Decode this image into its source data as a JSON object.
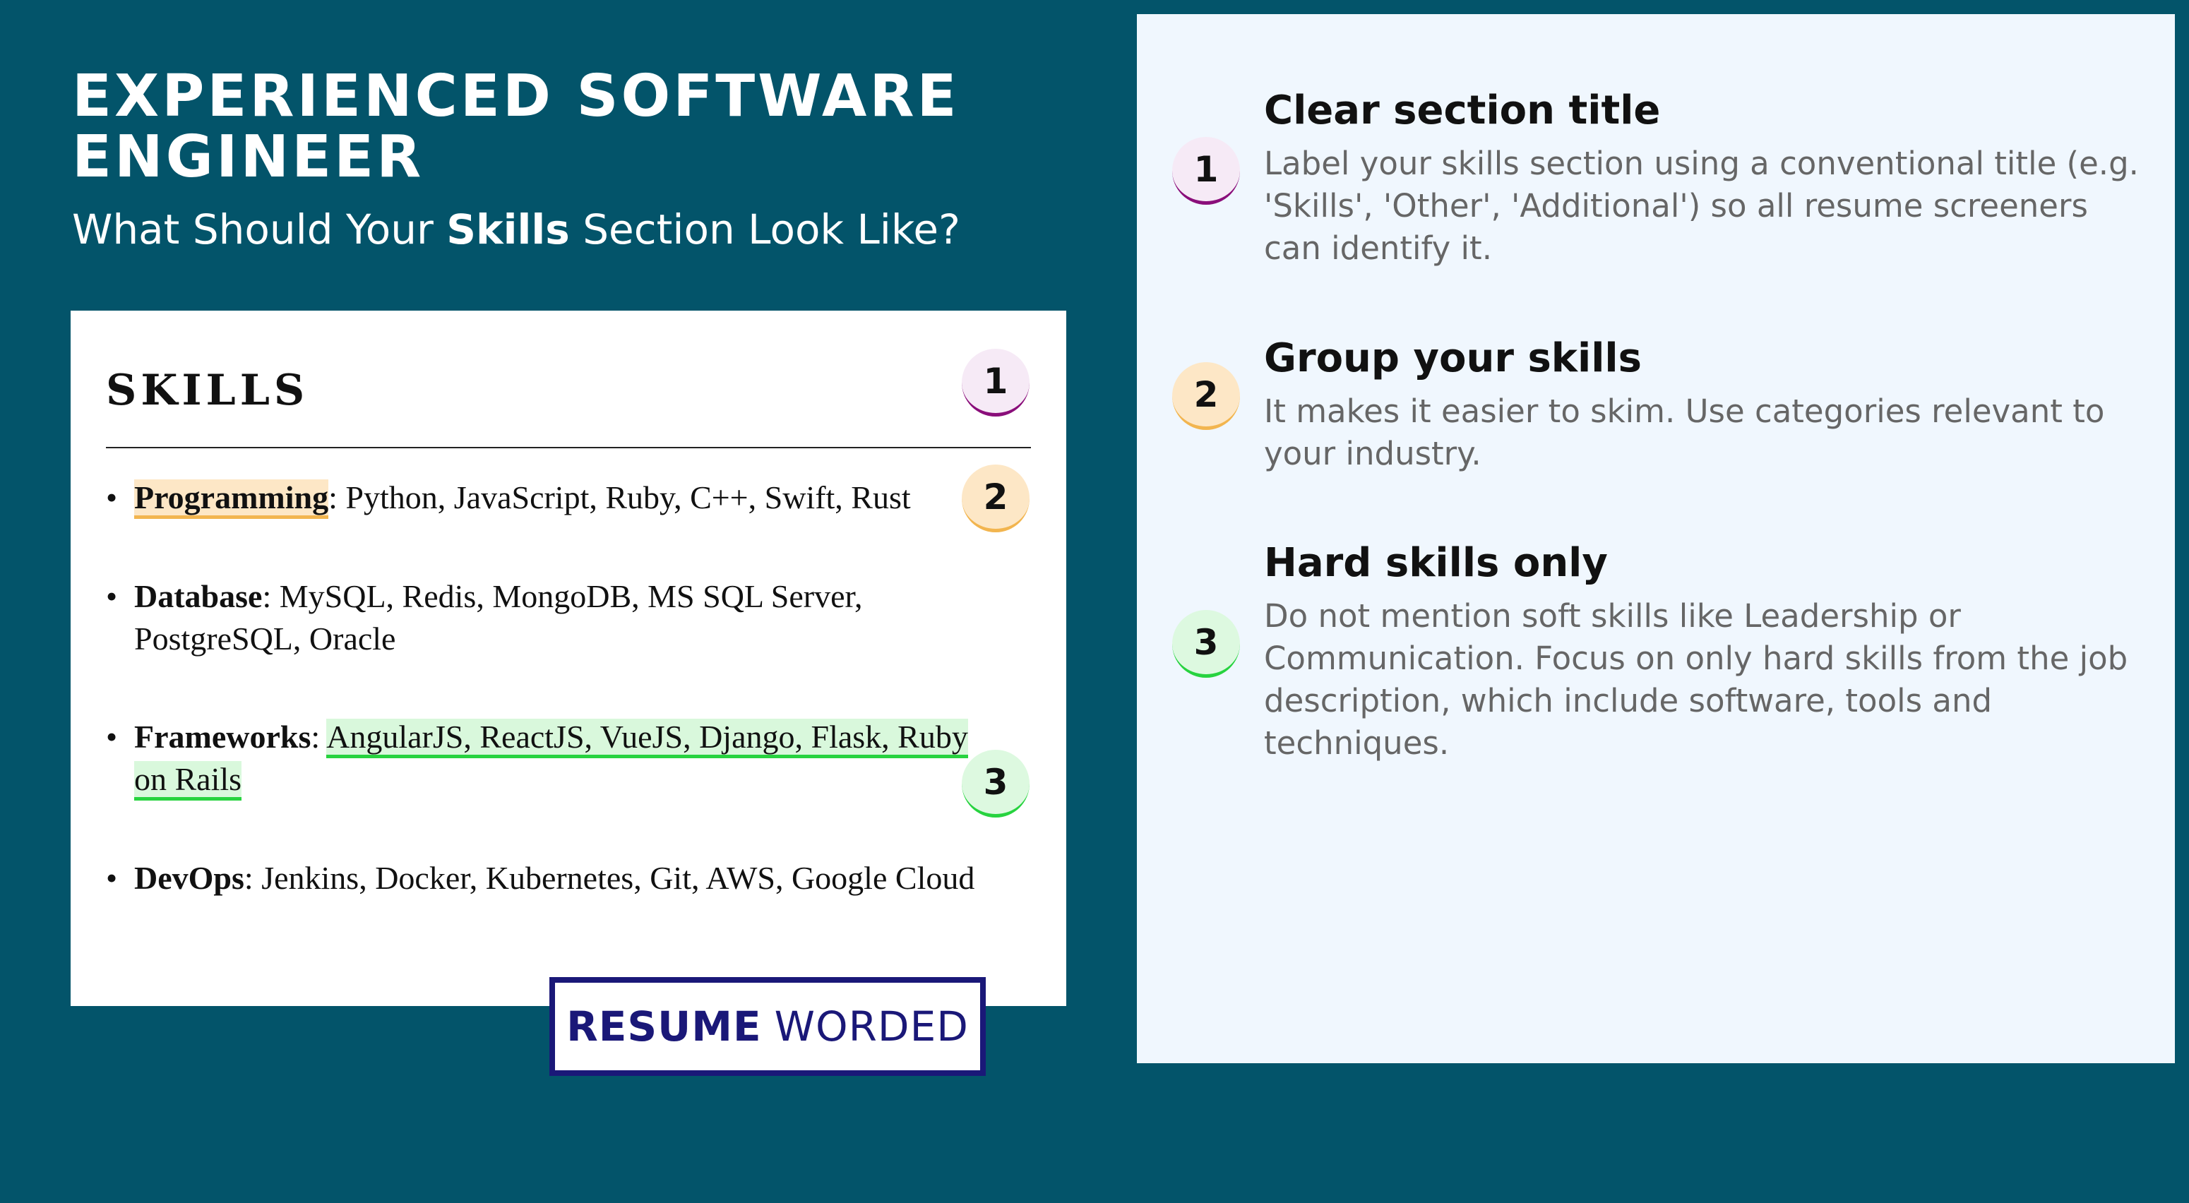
{
  "header": {
    "title": "EXPERIENCED SOFTWARE ENGINEER",
    "subtitle_before": "What Should Your ",
    "subtitle_bold": "Skills",
    "subtitle_after": " Section Look Like?"
  },
  "resume": {
    "heading": "SKILLS",
    "bullet": "•",
    "items": [
      {
        "label": "Programming",
        "sep": ": ",
        "text": "Python, JavaScript, Ruby, C++, Swift, Rust"
      },
      {
        "label": "Database",
        "sep": ": ",
        "text": "MySQL, Redis, MongoDB, MS SQL Server, PostgreSQL, Oracle"
      },
      {
        "label": "Frameworks",
        "sep": ": ",
        "text": "AngularJS, ReactJS, VueJS, Django, Flask, Ruby on Rails"
      },
      {
        "label": "DevOps",
        "sep": ": ",
        "text": "Jenkins, Docker, Kubernetes, Git, AWS, Google Cloud"
      }
    ],
    "badges": [
      "1",
      "2",
      "3"
    ]
  },
  "logo": {
    "strong": "RESUME",
    "light": "WORDED"
  },
  "tips": [
    {
      "number": "1",
      "title": "Clear section title",
      "body": "Label your skills section using a conventional title (e.g. 'Skills', 'Other', 'Additional') so all resume screeners can identify it."
    },
    {
      "number": "2",
      "title": "Group your skills",
      "body": "It makes it easier to skim. Use categories relevant to your industry."
    },
    {
      "number": "3",
      "title": "Hard skills only",
      "body": "Do not mention soft skills like Leadership or Communication. Focus on only hard skills from the job description, which include software, tools and techniques."
    }
  ],
  "colors": {
    "background": "#03546a",
    "badge1": "#8a0e7a",
    "badge2": "#f2b54f",
    "badge3": "#27d33f",
    "logo": "#1a1878"
  }
}
